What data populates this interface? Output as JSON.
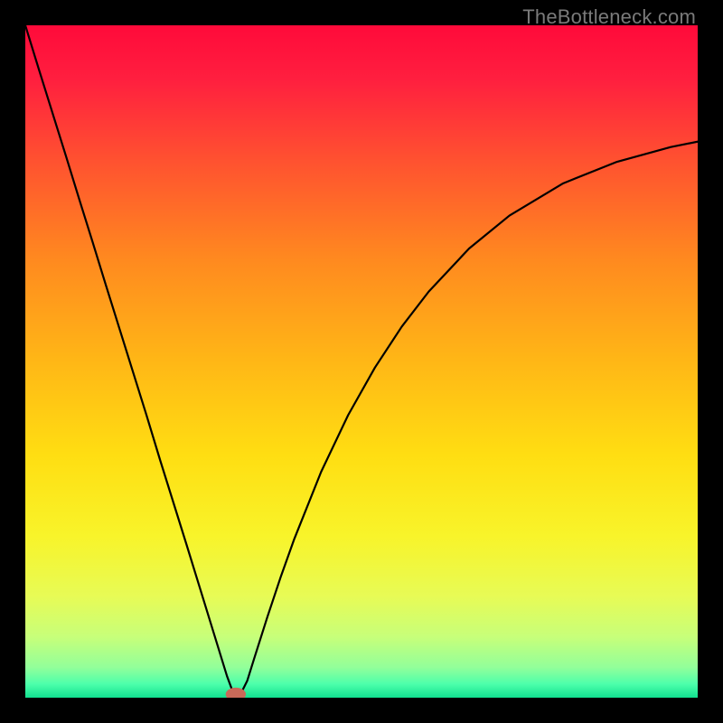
{
  "watermark": "TheBottleneck.com",
  "chart_data": {
    "type": "line",
    "title": "",
    "xlabel": "",
    "ylabel": "",
    "xlim": [
      0,
      100
    ],
    "ylim": [
      0,
      100
    ],
    "grid": false,
    "legend": false,
    "gradient_bands": [
      {
        "stop": 0.0,
        "color": "#ff0a3a"
      },
      {
        "stop": 0.08,
        "color": "#ff1f3f"
      },
      {
        "stop": 0.2,
        "color": "#ff5130"
      },
      {
        "stop": 0.35,
        "color": "#ff8a1f"
      },
      {
        "stop": 0.5,
        "color": "#ffb716"
      },
      {
        "stop": 0.64,
        "color": "#ffde12"
      },
      {
        "stop": 0.76,
        "color": "#f8f42a"
      },
      {
        "stop": 0.85,
        "color": "#e7fb56"
      },
      {
        "stop": 0.91,
        "color": "#c7ff7a"
      },
      {
        "stop": 0.955,
        "color": "#92ff9a"
      },
      {
        "stop": 0.98,
        "color": "#4cffab"
      },
      {
        "stop": 1.0,
        "color": "#11e08f"
      }
    ],
    "series": [
      {
        "name": "curve",
        "color": "#000000",
        "stroke_width": 2.2,
        "x": [
          0,
          2,
          4,
          6,
          8,
          10,
          12,
          14,
          16,
          18,
          20,
          22,
          24,
          26,
          28,
          30,
          31,
          32,
          33,
          34,
          36,
          38,
          40,
          44,
          48,
          52,
          56,
          60,
          66,
          72,
          80,
          88,
          96,
          100
        ],
        "y": [
          100.0,
          93.5,
          87.1,
          80.7,
          74.2,
          67.8,
          61.3,
          54.9,
          48.5,
          42.1,
          35.5,
          29.1,
          22.7,
          16.2,
          9.7,
          3.2,
          0.5,
          0.5,
          2.5,
          5.7,
          12.0,
          18.0,
          23.6,
          33.6,
          42.0,
          49.1,
          55.2,
          60.4,
          66.8,
          71.7,
          76.5,
          79.7,
          81.9,
          82.7
        ]
      }
    ],
    "marker": {
      "x": 31.3,
      "y": 0.5,
      "rx": 1.5,
      "ry": 1.0,
      "color": "#c96a59"
    }
  }
}
